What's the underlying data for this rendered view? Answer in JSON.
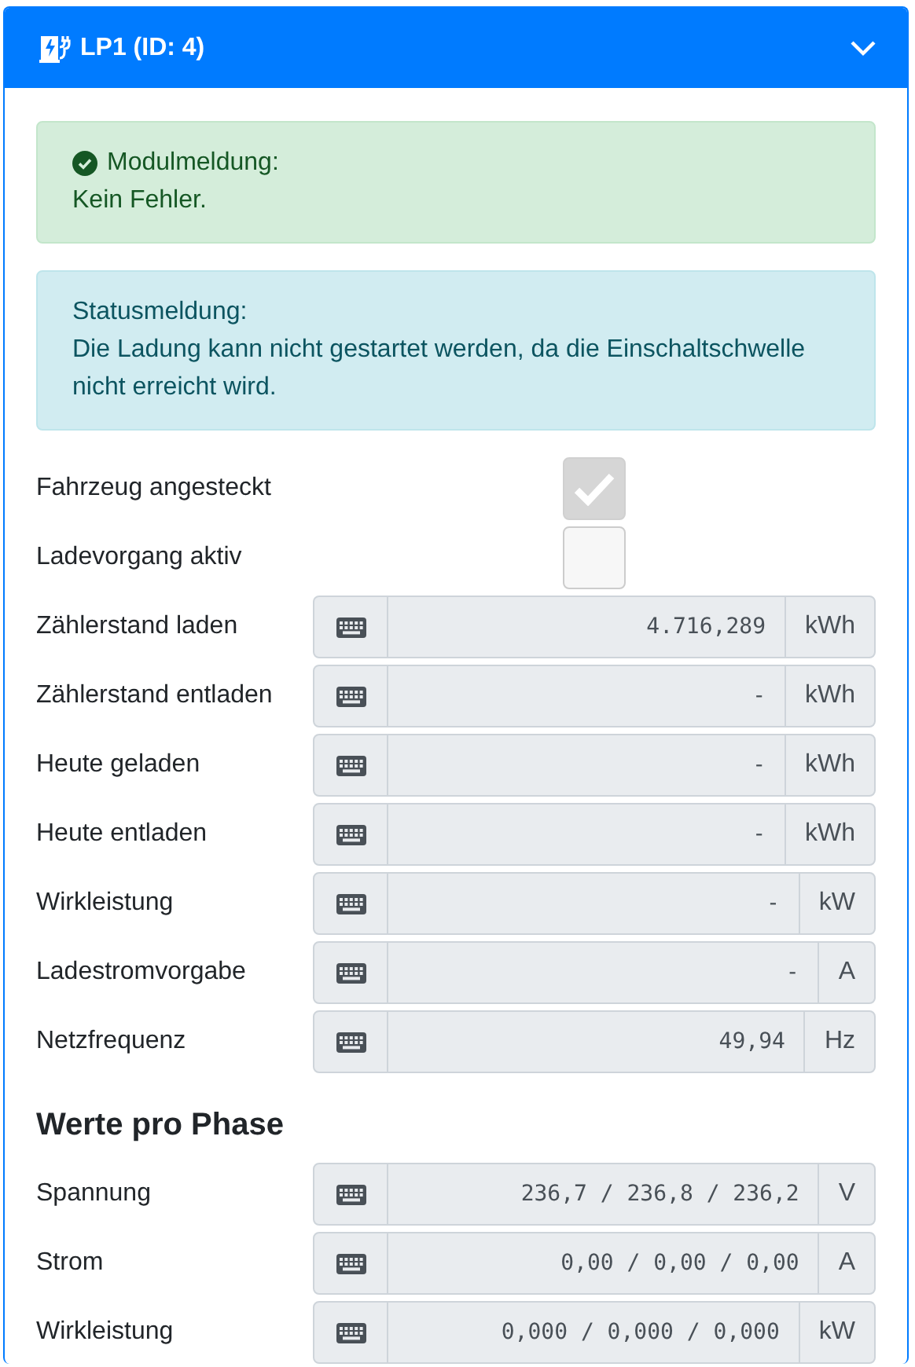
{
  "card": {
    "title": "LP1 (ID: 4)"
  },
  "alerts": [
    {
      "kind": "success",
      "title": "Modulmeldung:",
      "text": "Kein Fehler."
    },
    {
      "kind": "info",
      "title": "Statusmeldung:",
      "text": "Die Ladung kann nicht gestartet werden, da die Einschaltschwelle nicht erreicht wird."
    }
  ],
  "rows": [
    {
      "kind": "checkbox",
      "label": "Fahrzeug angesteckt",
      "checked": true
    },
    {
      "kind": "checkbox",
      "label": "Ladevorgang aktiv",
      "checked": false
    },
    {
      "kind": "value",
      "label": "Zählerstand laden",
      "value": "4.716,289",
      "unit": "kWh"
    },
    {
      "kind": "value",
      "label": "Zählerstand entladen",
      "value": "-",
      "unit": "kWh"
    },
    {
      "kind": "value",
      "label": "Heute geladen",
      "value": "-",
      "unit": "kWh"
    },
    {
      "kind": "value",
      "label": "Heute entladen",
      "value": "-",
      "unit": "kWh"
    },
    {
      "kind": "value",
      "label": "Wirkleistung",
      "value": "-",
      "unit": "kW"
    },
    {
      "kind": "value",
      "label": "Ladestromvorgabe",
      "value": "-",
      "unit": "A"
    },
    {
      "kind": "value",
      "label": "Netzfrequenz",
      "value": "49,94",
      "unit": "Hz"
    }
  ],
  "phase_section": {
    "heading": "Werte pro Phase",
    "rows": [
      {
        "kind": "value",
        "label": "Spannung",
        "value": "236,7 / 236,8 / 236,2",
        "unit": "V"
      },
      {
        "kind": "value",
        "label": "Strom",
        "value": "0,00 / 0,00 / 0,00",
        "unit": "A"
      },
      {
        "kind": "value",
        "label": "Wirkleistung",
        "value": "0,000 / 0,000 / 0,000",
        "unit": "kW"
      }
    ]
  }
}
